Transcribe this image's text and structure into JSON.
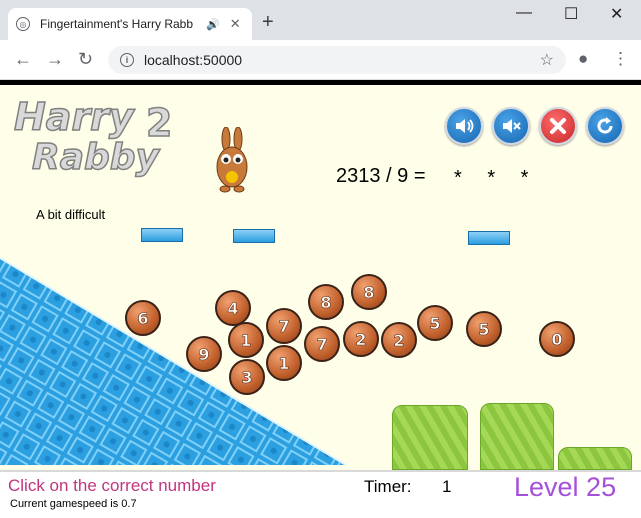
{
  "browser": {
    "tab_title": "Fingertainment's Harry Rabb",
    "url": "localhost:50000",
    "new_tab": "+",
    "minimize": "—",
    "maximize": "☐",
    "close": "✕"
  },
  "game": {
    "logo_line1": "Harry",
    "logo_number": "2",
    "logo_line2": "Rabby",
    "question": "2313 / 9 =",
    "answer_mask": "* * *",
    "difficulty": "A bit difficult",
    "status_instruction": "Click on the correct number",
    "status_speed": "Current gamespeed is 0.7",
    "timer_label": "Timer:",
    "timer_value": "1",
    "level": "Level 25",
    "balls": [
      "6",
      "4",
      "8",
      "8",
      "1",
      "7",
      "9",
      "7",
      "2",
      "2",
      "5",
      "5",
      "0",
      "3",
      "1"
    ]
  },
  "colors": {
    "game_bg": "#fffee9",
    "tile_blue": "#2b9fe0",
    "ball_orange": "#c0602c",
    "level_purple": "#a64fd8",
    "instruction_pink": "#c2357e"
  },
  "icons": {
    "sound_on": "speaker-on-icon",
    "mute": "speaker-mute-icon",
    "close": "close-icon",
    "restart": "restart-icon"
  }
}
